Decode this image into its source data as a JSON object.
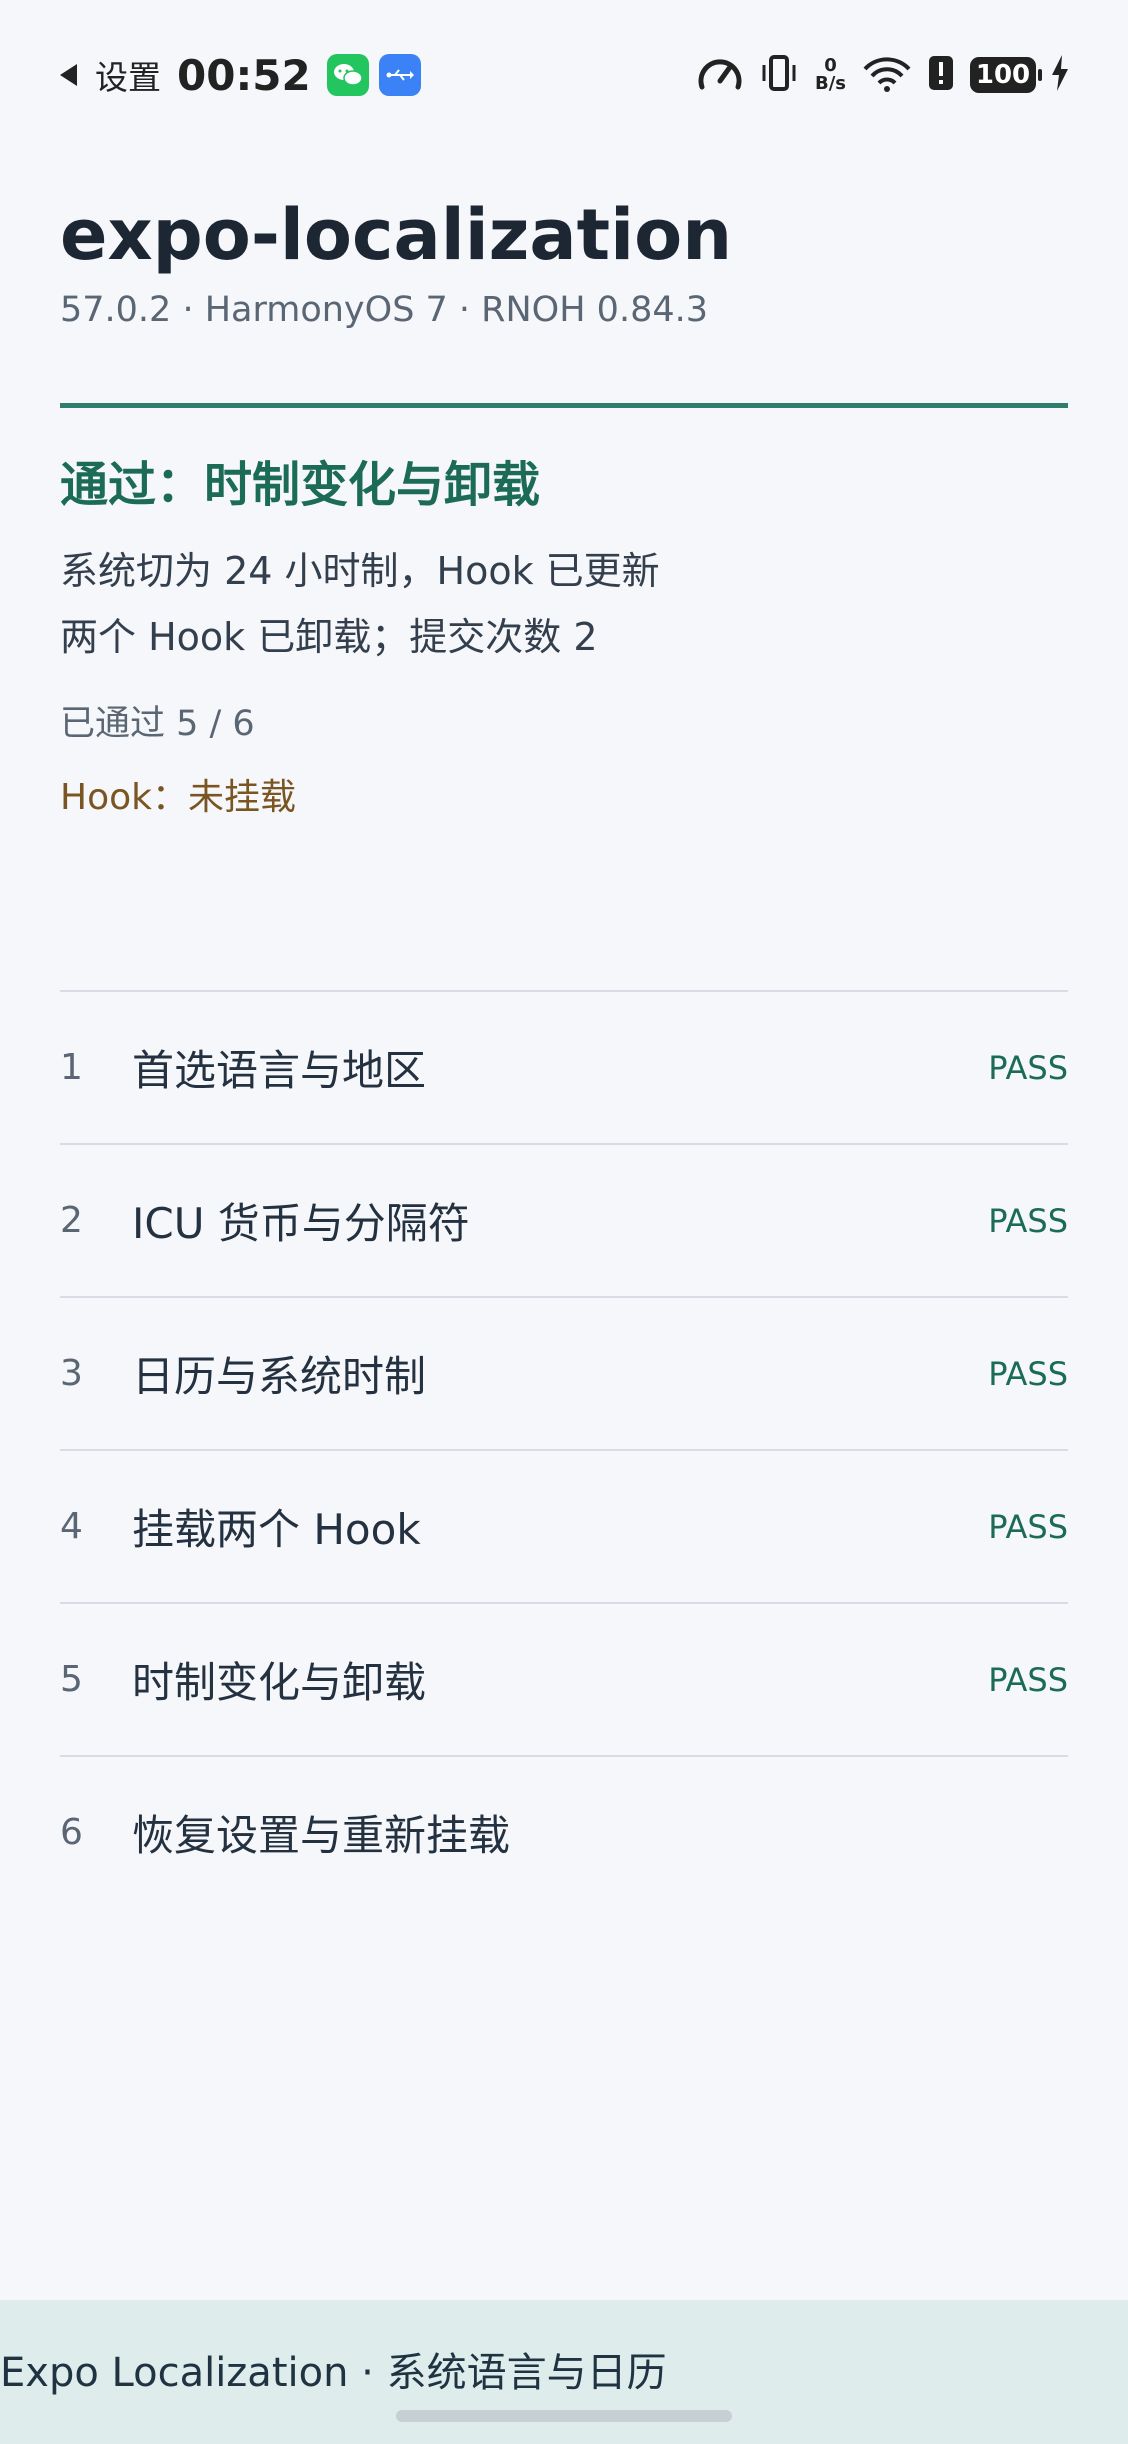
{
  "status_bar": {
    "back_label": "设置",
    "time": "00:52",
    "net_speed_value": "0",
    "net_speed_unit": "B/s",
    "battery": "100"
  },
  "header": {
    "title": "expo-localization",
    "subtitle": "57.0.2 · HarmonyOS 7 · RNOH 0.84.3"
  },
  "result": {
    "title": "通过：时制变化与卸载",
    "detail_lines": [
      "系统切为 24 小时制，Hook 已更新",
      "两个 Hook 已卸载；提交次数 2"
    ],
    "passed_count": "已通过 5 / 6",
    "hook_status": "Hook：未挂载"
  },
  "tests": [
    {
      "num": "1",
      "name": "首选语言与地区",
      "status": "PASS"
    },
    {
      "num": "2",
      "name": "ICU 货币与分隔符",
      "status": "PASS"
    },
    {
      "num": "3",
      "name": "日历与系统时制",
      "status": "PASS"
    },
    {
      "num": "4",
      "name": "挂载两个 Hook",
      "status": "PASS"
    },
    {
      "num": "5",
      "name": "时制变化与卸载",
      "status": "PASS"
    },
    {
      "num": "6",
      "name": "恢复设置与重新挂载",
      "status": ""
    }
  ],
  "bottom_bar": {
    "text": "Expo Localization · 系统语言与日历"
  },
  "colors": {
    "accent": "#2e7d6f",
    "pass": "#1b6b57",
    "hook_warning": "#7a5522",
    "bottom_bar_bg": "#deecec"
  }
}
